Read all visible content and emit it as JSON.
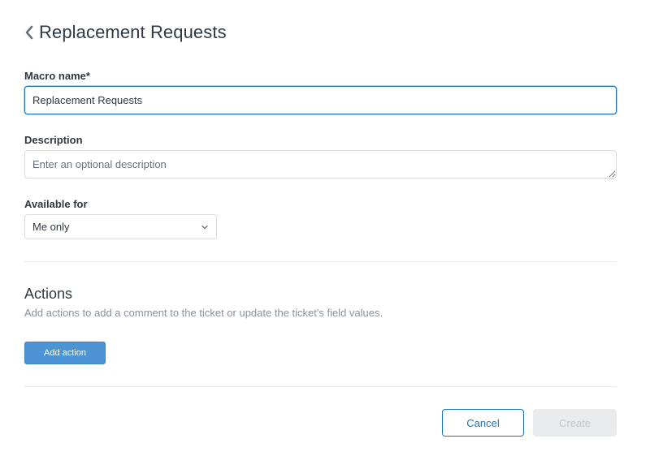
{
  "header": {
    "title": "Replacement Requests",
    "back_icon": "chevron-left-icon"
  },
  "form": {
    "macro_name": {
      "label": "Macro name*",
      "value": "Replacement Requests"
    },
    "description": {
      "label": "Description",
      "placeholder": "Enter an optional description",
      "value": ""
    },
    "available_for": {
      "label": "Available for",
      "selected": "Me only",
      "icon": "chevron-down-icon"
    }
  },
  "actions": {
    "title": "Actions",
    "description": "Add actions to add a comment to the ticket or update the ticket's field values.",
    "add_label": "Add action"
  },
  "footer": {
    "cancel_label": "Cancel",
    "create_label": "Create"
  },
  "colors": {
    "accent": "#1f73b7",
    "primary_button": "#4d94d6",
    "disabled": "#e9ebed",
    "border": "#d8dcde",
    "text": "#2f3941",
    "muted": "#87929d"
  }
}
